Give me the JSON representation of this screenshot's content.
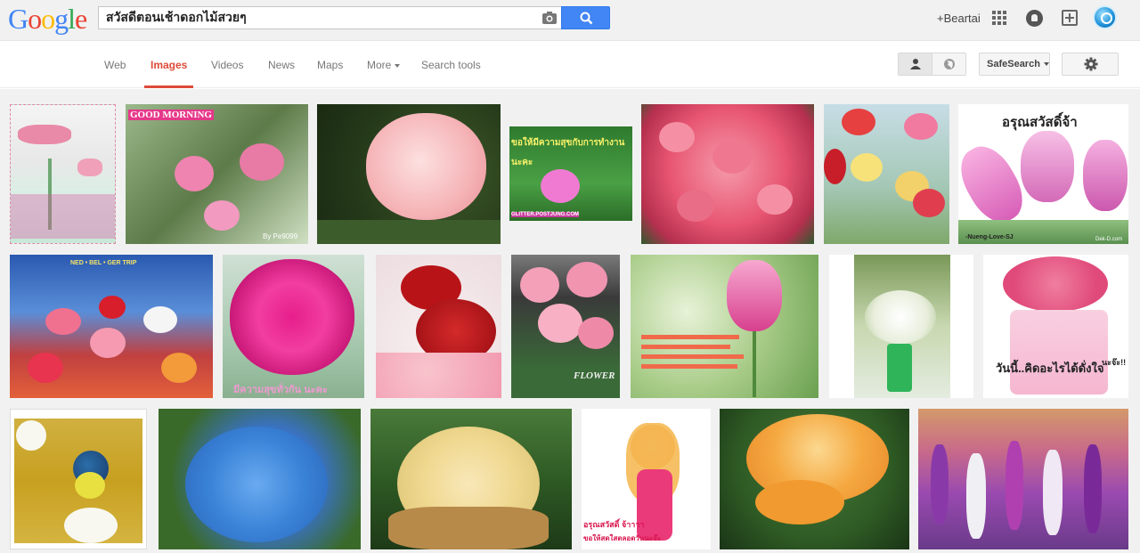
{
  "header": {
    "logo": [
      "G",
      "o",
      "o",
      "g",
      "l",
      "e"
    ],
    "search_value": "สวัสดีตอนเช้าดอกไม้สวยๆ",
    "user_name": "+Beartai"
  },
  "nav": {
    "tabs": [
      {
        "label": "Web"
      },
      {
        "label": "Images"
      },
      {
        "label": "Videos"
      },
      {
        "label": "News"
      },
      {
        "label": "Maps"
      },
      {
        "label": "More"
      },
      {
        "label": "Search tools"
      }
    ],
    "safesearch_label": "SafeSearch"
  },
  "colors": {
    "accent": "#dd4b39",
    "search_blue": "#4285f4",
    "logo": [
      "#4285f4",
      "#ea4335",
      "#fbbc05",
      "#4285f4",
      "#34a853",
      "#ea4335"
    ]
  },
  "results": {
    "row1": [
      {
        "caption": "",
        "subject": "pink-rose-vase"
      },
      {
        "caption": "GOOD MORNING",
        "signature": "By Pe9099",
        "subject": "pink-flowers"
      },
      {
        "caption": "",
        "subject": "pink-rose"
      },
      {
        "caption": "ขอให้มีความสุขกับการทำงานนะคะ",
        "watermark": "GLITTER.POSTJUNG.COM",
        "subject": "pink-flower-card"
      },
      {
        "caption": "",
        "subject": "pink-roses-bouquet"
      },
      {
        "caption": "",
        "subject": "gerbera-vase"
      },
      {
        "caption": "อรุณสวัสดิ์จ้า",
        "signature": "-Nueng-Love-SJ",
        "watermark": "Dek-D.com",
        "subject": "pink-tulips"
      }
    ],
    "row2": [
      {
        "caption": "NED • BEL • GER TRIP",
        "subject": "red-gerberas"
      },
      {
        "caption": "มีความสุขทั่วกัน นะคะ",
        "subject": "magenta-peony"
      },
      {
        "caption": "",
        "subject": "red-roses"
      },
      {
        "caption": "",
        "watermark": "FLOWER",
        "subject": "pink-roses"
      },
      {
        "caption": "",
        "subject": "pink-tulip-card"
      },
      {
        "caption": "",
        "subject": "white-flowers-vase"
      },
      {
        "caption": "วันนี้..คิดอะไรได้ดั่งใจ",
        "signature": "นะจ๊ะ!!",
        "subject": "pink-rose-ball"
      }
    ],
    "row3": [
      {
        "caption": "",
        "subject": "bird-blossom"
      },
      {
        "caption": "",
        "subject": "blue-hydrangea"
      },
      {
        "caption": "",
        "subject": "white-flowers-basket"
      },
      {
        "caption": "อรุณสวัสดิ์ จ้าาาา",
        "signature": "ขอให้สดใสตลอดวันนะจ๊ะ",
        "subject": "cartoon-girl"
      },
      {
        "caption": "",
        "subject": "orange-rose"
      },
      {
        "caption": "",
        "subject": "purple-flower-field"
      }
    ]
  }
}
